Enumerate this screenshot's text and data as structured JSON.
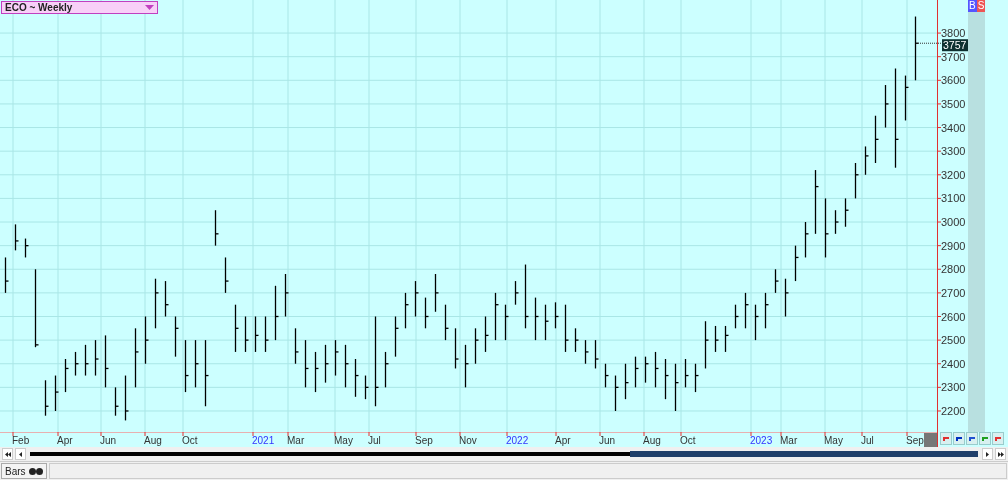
{
  "chart_title": "ECO ~ Weekly",
  "legend": [
    "B",
    "S"
  ],
  "last_price": "3757",
  "y_axis_labels": [
    "3800",
    "3700",
    "3600",
    "3500",
    "3400",
    "3300",
    "3200",
    "3100",
    "3000",
    "2900",
    "2800",
    "2700",
    "2600",
    "2500",
    "2400",
    "2300",
    "2200"
  ],
  "x_axis_labels": [
    {
      "text": "Feb",
      "kind": "month"
    },
    {
      "text": "Apr",
      "kind": "month"
    },
    {
      "text": "Jun",
      "kind": "month"
    },
    {
      "text": "Aug",
      "kind": "month"
    },
    {
      "text": "Oct",
      "kind": "month"
    },
    {
      "text": "2021",
      "kind": "year"
    },
    {
      "text": "Mar",
      "kind": "month"
    },
    {
      "text": "May",
      "kind": "month"
    },
    {
      "text": "Jul",
      "kind": "month"
    },
    {
      "text": "Sep",
      "kind": "month"
    },
    {
      "text": "Nov",
      "kind": "month"
    },
    {
      "text": "2022",
      "kind": "year"
    },
    {
      "text": "Apr",
      "kind": "month"
    },
    {
      "text": "Jun",
      "kind": "month"
    },
    {
      "text": "Aug",
      "kind": "month"
    },
    {
      "text": "Oct",
      "kind": "month"
    },
    {
      "text": "2023",
      "kind": "year"
    },
    {
      "text": "Mar",
      "kind": "month"
    },
    {
      "text": "May",
      "kind": "month"
    },
    {
      "text": "Jul",
      "kind": "month"
    },
    {
      "text": "Sep",
      "kind": "month"
    }
  ],
  "status_bar": {
    "label": "Bars"
  }
}
